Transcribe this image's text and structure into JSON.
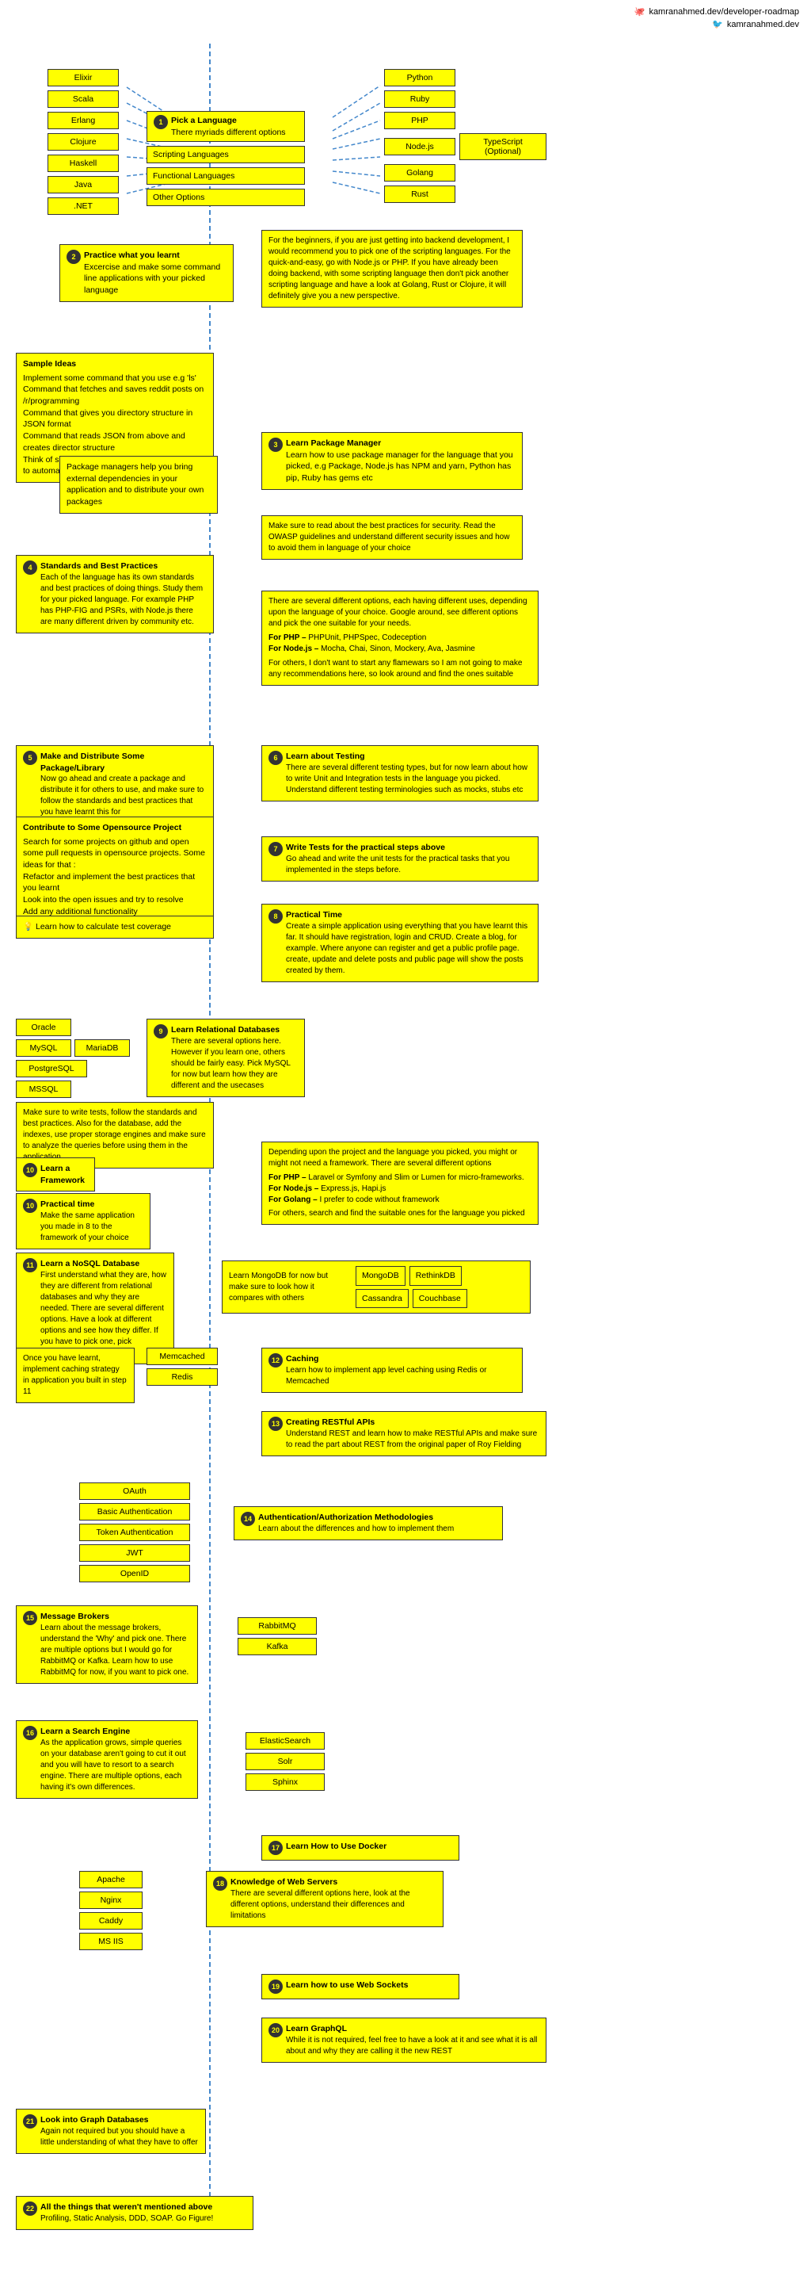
{
  "header": {
    "github": "kamranahmed.dev/developer-roadmap",
    "twitter": "kamranahmed.dev",
    "github_icon": "🐙",
    "twitter_icon": "🐦"
  },
  "step1": {
    "number": "1",
    "title": "Pick a Language",
    "subtitle": "There myriads different options",
    "left_langs": [
      "Elixir",
      "Scala",
      "Erlang",
      "Clojure",
      "Haskell",
      "Java",
      ".NET"
    ],
    "center_labels": [
      "Scripting Languages",
      "Functional Languages",
      "Other Options"
    ],
    "right_langs_col1": [
      "Python",
      "Ruby",
      "PHP",
      "Node.js",
      "Golang",
      "Rust"
    ],
    "typescript_label": "TypeScript (Optional)"
  },
  "step2": {
    "number": "2",
    "title": "Practice what you learnt",
    "subtitle": "Excercise and make some command line applications with your picked language"
  },
  "step2_advice": {
    "text": "For the beginners, if you are just getting into backend development, I would recommend you to pick one of the scripting languages. For the quick-and-easy, go with Node.js or PHP. If you have already been doing backend, with some scripting language then don't pick another scripting language and have a look at Golang, Rust or Clojure, it will definitely give you a new perspective."
  },
  "sample_ideas": {
    "title": "Sample Ideas",
    "items": [
      "Implement some command that you use e.g 'ls'",
      "Command that fetches and saves reddit posts on /r/programming",
      "Command that gives you directory structure in JSON format",
      "Command that reads JSON from above and creates director structure",
      "Think of some task that you do every day and try to automate that"
    ]
  },
  "pkg_manager_note": "Package managers help you bring external dependencies in your application and to distribute your own packages",
  "step3": {
    "number": "3",
    "title": "Learn Package Manager",
    "text": "Learn how to use package manager for the language that you picked, e.g Package, Node.js has NPM and yarn, Python has pip, Ruby has gems etc"
  },
  "security_note": "Make sure to read about the best practices for security. Read the OWASP guidelines and understand different security issues and how to avoid them in language of your choice",
  "step4": {
    "number": "4",
    "title": "Standards and Best Practices",
    "text": "Each of the language has its own standards and best practices of doing things. Study them for your picked language. For example PHP has PHP-FIG and PSRs, with Node.js there are many different driven by community etc."
  },
  "testing_frameworks": {
    "intro": "There are several different options, each having different uses, depending upon the language of your choice. Google around, see different options and pick the one suitable for your needs.",
    "php_label": "For PHP –",
    "php_options": "PHPUnit, PHPSpec, Codeception",
    "nodejs_label": "For Node.js –",
    "nodejs_options": "Mocha, Chai, Sinon, Mockery, Ava, Jasmine",
    "others": "For others, I don't want to start any flamewars so I am not going to make any recommendations here, so look around and find the ones suitable"
  },
  "step5": {
    "number": "5",
    "title": "Make and Distribute Some Package/Library",
    "text": "Now go ahead and create a package and distribute it for others to use, and make sure to follow the standards and best practices that you have learnt this for"
  },
  "opensource": {
    "title": "Contribute to Some Opensource Project",
    "items": [
      "Search for some projects on github and open some pull requests in opensource projects. Some ideas for that :",
      "Refactor and implement the best practices that you learnt",
      "Look into the open issues and try to resolve",
      "Add any additional functionality"
    ]
  },
  "test_coverage": "💡  Learn how to calculate test coverage",
  "step6": {
    "number": "6",
    "title": "Learn about Testing",
    "text": "There are several different testing types, but for now learn about how to write Unit and Integration tests in the language you picked. Understand different testing terminologies such as mocks, stubs etc"
  },
  "step7": {
    "number": "7",
    "title": "Write Tests for the practical steps above",
    "text": "Go ahead and write the unit tests for the practical tasks that you implemented in the steps before."
  },
  "step8": {
    "number": "8",
    "title": "Practical Time",
    "text": "Create a simple application using everything that you have learnt this far. It should have registration, login and CRUD. Create a blog, for example. Where anyone can register and get a public profile page. create, update and delete posts and public page will show the posts created by them."
  },
  "databases_left": [
    "Oracle",
    "MySQL",
    "MariaDB",
    "PostgreSQL",
    "MSSQL"
  ],
  "step9": {
    "number": "9",
    "title": "Learn Relational Databases",
    "text": "There are several options here. However if you learn one, others should be fairly easy. Pick MySQL for now but learn how they are different and the usecases"
  },
  "db_note": "Make sure to write tests, follow the standards and best practices. Also for the database, add the indexes, use proper storage engines and make sure to analyze the queries before using them in the application.",
  "step10": {
    "number": "10",
    "title": "Learn a Framework",
    "text_note": ""
  },
  "step10_practical": {
    "number": "10",
    "title": "Practical time",
    "text": "Make the same application you made in 8 to the framework of your choice"
  },
  "framework_options": {
    "text": "Depending upon the project and the language you picked, you might or might not need a framework. There are several different options",
    "php": "For PHP – Laravel or Symfony and Slim or Lumen for micro-frameworks.",
    "nodejs": "For Node.js – Express.js, Hapi.js",
    "golang": "For Golang – I prefer to code without framework",
    "others": "For others, search and find the suitable ones for the language you picked"
  },
  "step11": {
    "number": "11",
    "title": "Learn a NoSQL Database",
    "text": "First understand what they are, how they are different from relational databases and why they are needed. There are several different options. Have a look at different options and see how they differ. If you have to pick one, pick MongoDB."
  },
  "nosql_dbs": {
    "left": "Learn MongoDB for now but make sure to look how it compares with others",
    "options": [
      "MongoDB",
      "RethinkDB",
      "Cassandra",
      "Couchbase"
    ]
  },
  "caching_note": "Once you have learnt, implement caching strategy in application you built in step 11",
  "caching_tools": [
    "Memcached",
    "Redis"
  ],
  "step12": {
    "number": "12",
    "title": "Caching",
    "text": "Learn how to implement app level caching using Redis or Memcached"
  },
  "step13": {
    "number": "13",
    "title": "Creating RESTful APIs",
    "text": "Understand REST and learn how to make RESTful APIs and make sure to read the part about REST from the original paper of Roy Fielding"
  },
  "auth_methods": [
    "OAuth",
    "Basic Authentication",
    "Token Authentication",
    "JWT",
    "OpenID"
  ],
  "step14": {
    "number": "14",
    "title": "Authentication/Authorization Methodologies",
    "text": "Learn about the differences and how to implement them"
  },
  "step15": {
    "number": "15",
    "title": "Message Brokers",
    "text": "Learn about the message brokers, understand the 'Why' and pick one. There are multiple options but I would go for RabbitMQ or Kafka. Learn how to use RabbitMQ for now, if you want to pick one."
  },
  "message_brokers": [
    "RabbitMQ",
    "Kafka"
  ],
  "step16": {
    "number": "16",
    "title": "Learn a Search Engine",
    "text": "As the application grows, simple queries on your database aren't going to cut it out and you will have to resort to a search engine. There are multiple options, each having it's own differences."
  },
  "search_engines": [
    "ElasticSearch",
    "Solr",
    "Sphinx"
  ],
  "step17": {
    "number": "17",
    "title": "Learn How to Use Docker"
  },
  "web_servers_left": [
    "Apache",
    "Nginx",
    "Caddy",
    "MS IIS"
  ],
  "step18": {
    "number": "18",
    "title": "Knowledge of Web Servers",
    "text": "There are several different options here, look at the different options, understand their differences and limitations"
  },
  "step19": {
    "number": "19",
    "title": "Learn how to use Web Sockets"
  },
  "step20": {
    "number": "20",
    "title": "Learn GraphQL",
    "text": "While it is not required, feel free to have a look at it and see what it is all about and why they are calling it the new REST"
  },
  "step21": {
    "number": "21",
    "title": "Look into Graph Databases",
    "text": "Again not required but you should have a little understanding of what they have to offer"
  },
  "step22": {
    "number": "22",
    "title": "All the things that weren't mentioned above",
    "text": "Profiling, Static Analysis, DDD, SOAP. Go Figure!"
  }
}
